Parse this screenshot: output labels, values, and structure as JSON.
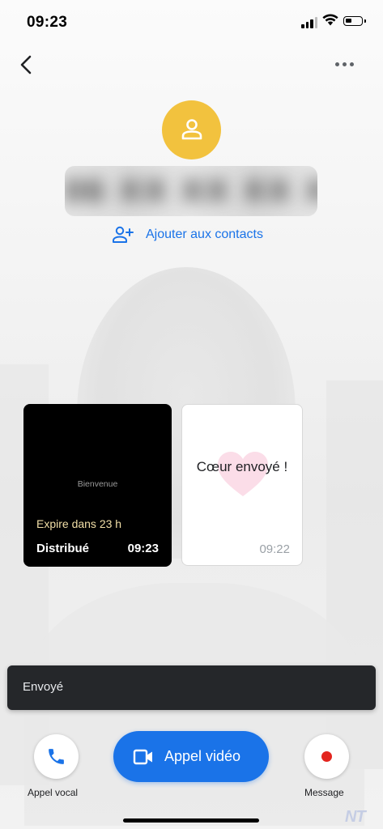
{
  "status_bar": {
    "time": "09:23"
  },
  "header": {
    "back_icon": "chevron-left-icon",
    "more_icon": "more-horizontal-icon"
  },
  "contact": {
    "avatar_icon": "person-icon",
    "avatar_color": "#f2c23e",
    "phone_number_blurred": "06 XX XX XX XX",
    "add_contact_label": "Ajouter aux contacts",
    "add_contact_icon": "person-add-icon"
  },
  "messages": [
    {
      "type": "video",
      "welcome_text": "Bienvenue",
      "expire_text": "Expire dans 23 h",
      "status": "Distribué",
      "time": "09:23"
    },
    {
      "type": "heart",
      "text": "Cœur envoyé !",
      "time": "09:22"
    }
  ],
  "toast": {
    "text": "Envoyé"
  },
  "actions": {
    "voice_call_label": "Appel vocal",
    "voice_call_icon": "phone-icon",
    "video_call_label": "Appel vidéo",
    "video_call_icon": "videocam-icon",
    "message_label": "Message",
    "message_icon": "record-dot-icon"
  },
  "colors": {
    "accent": "#1a73e8",
    "record": "#e3251e",
    "toast_bg": "#25272a"
  },
  "watermark": "NT"
}
